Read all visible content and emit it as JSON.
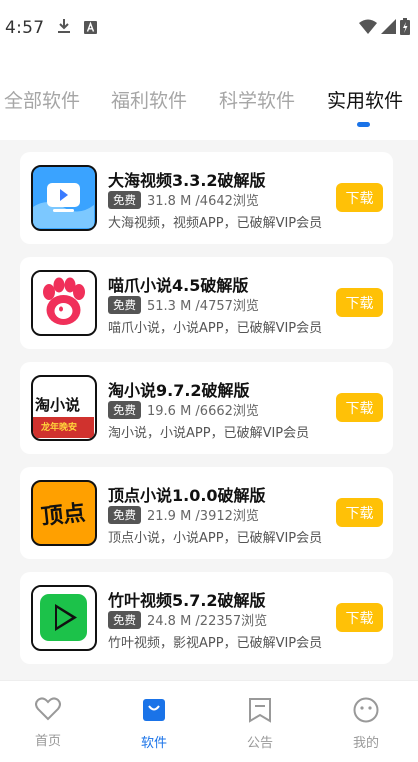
{
  "status_bar": {
    "time": "4:57",
    "icons": [
      "download-icon",
      "notification-a-icon",
      "wifi-icon",
      "signal-icon",
      "battery-icon"
    ]
  },
  "tabs": [
    {
      "label": "全部软件",
      "active": false
    },
    {
      "label": "福利软件",
      "active": false
    },
    {
      "label": "科学软件",
      "active": false
    },
    {
      "label": "实用软件",
      "active": true
    }
  ],
  "apps": [
    {
      "name": "大海视频3.3.2破解版",
      "badge": "免费",
      "meta": "31.8 M /4642浏览",
      "desc": "大海视频，视频APP，已破解VIP会员",
      "button": "下载",
      "icon": "video-play-icon"
    },
    {
      "name": "喵爪小说4.5破解版",
      "badge": "免费",
      "meta": "51.3 M /4757浏览",
      "desc": "喵爪小说，小说APP，已破解VIP会员",
      "button": "下载",
      "icon": "cat-paw-icon"
    },
    {
      "name": "淘小说9.7.2破解版",
      "badge": "免费",
      "meta": "19.6 M /6662浏览",
      "desc": "淘小说，小说APP，已破解VIP会员",
      "button": "下载",
      "icon": "tao-novel-icon",
      "icon_text": "淘小说",
      "icon_subtext": "龙年晚安"
    },
    {
      "name": "顶点小说1.0.0破解版",
      "badge": "免费",
      "meta": "21.9 M /3912浏览",
      "desc": "顶点小说，小说APP，已破解VIP会员",
      "button": "下载",
      "icon": "dingdian-icon",
      "icon_text": "顶点"
    },
    {
      "name": "竹叶视频5.7.2破解版",
      "badge": "免费",
      "meta": "24.8 M /22357浏览",
      "desc": "竹叶视频，影视APP，已破解VIP会员",
      "button": "下载",
      "icon": "green-play-icon"
    }
  ],
  "bottom_nav": [
    {
      "label": "首页",
      "icon": "heart-icon",
      "active": false
    },
    {
      "label": "软件",
      "icon": "bag-icon",
      "active": true
    },
    {
      "label": "公告",
      "icon": "bookmark-icon",
      "active": false
    },
    {
      "label": "我的",
      "icon": "smile-icon",
      "active": false
    }
  ],
  "colors": {
    "accent": "#1a73e8",
    "download_button": "#ffc107",
    "badge": "#555555",
    "background": "#f5f5f5"
  }
}
